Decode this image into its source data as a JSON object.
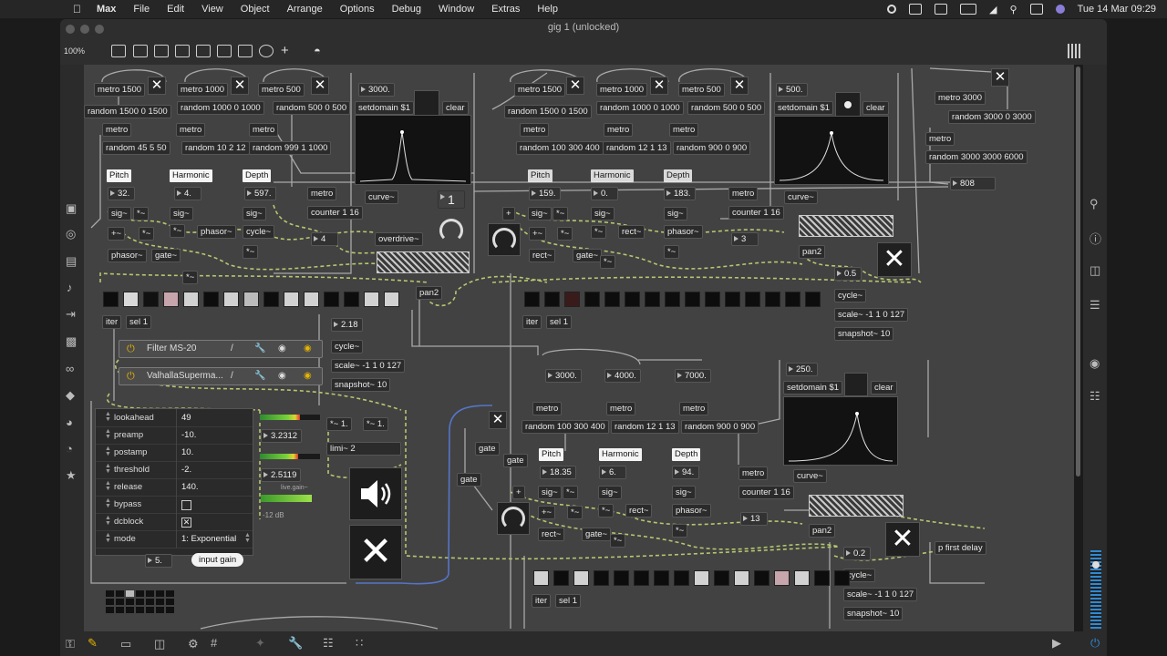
{
  "menubar": {
    "app": "Max",
    "items": [
      "File",
      "Edit",
      "View",
      "Object",
      "Arrange",
      "Options",
      "Debug",
      "Window",
      "Extras",
      "Help"
    ],
    "clock": "Tue 14 Mar  09:29"
  },
  "window": {
    "title": "gig 1 (unlocked)",
    "zoom": "100%"
  },
  "patch_a": {
    "metros": [
      "metro 1500",
      "metro 1000",
      "metro 500"
    ],
    "randoms": [
      "random 1500 0 1500",
      "random 1000 0 1000",
      "random 500 0 500"
    ],
    "metro_small": "metro",
    "rand_params": [
      "random 45 5 50",
      "random 10 2 12",
      "random 999 1 1000"
    ],
    "labels": [
      "Pitch",
      "Harmonic",
      "Depth"
    ],
    "values": [
      "32.",
      "4.",
      "597."
    ],
    "sig": "sig~",
    "star": "*~",
    "plus": "+~",
    "phasor": "phasor~",
    "cycle": "cycle~",
    "gate": "gate~",
    "tri": "*~",
    "number_top": "3000.",
    "setdomain": "setdomain $1",
    "clear": "clear",
    "counter": "counter 1 16",
    "counter_val": "4",
    "curve": "curve~",
    "one": "1",
    "overdrive": "overdrive~",
    "pan": "pan2",
    "iter": "iter",
    "sel": "sel 1",
    "cyc_val": "2.18",
    "scale": "scale~ -1 1 0 127",
    "snapshot": "snapshot~ 10"
  },
  "patch_b": {
    "metros": [
      "metro 1500",
      "metro 1000",
      "metro 500"
    ],
    "randoms": [
      "random 1500 0 1500",
      "random 1000 0 1000",
      "random 500 0 500"
    ],
    "rand_params": [
      "random 100 300 400",
      "random 12 1 13",
      "random 900 0 900"
    ],
    "labels": [
      "Pitch",
      "Harmonic",
      "Depth"
    ],
    "values": [
      "159.",
      "0.",
      "183."
    ],
    "number_top": "500.",
    "counter_val": "3",
    "rect": "rect~",
    "cyc_val": "0.5",
    "plus": "+"
  },
  "patch_c": {
    "metro": "metro 3000",
    "random1": "random 3000 0 3000",
    "metro2": "metro",
    "random2": "random 3000 3000 6000",
    "value": "808"
  },
  "patch_d": {
    "numbers": [
      "3000.",
      "4000.",
      "7000."
    ],
    "rand_params": [
      "random 100 300 400",
      "random 12 1 13",
      "random 900 0 900"
    ],
    "labels": [
      "Pitch",
      "Harmonic",
      "Depth"
    ],
    "values": [
      "18.35",
      "6.",
      "94."
    ],
    "number_top": "250.",
    "counter_val": "13",
    "cyc_val": "0.2",
    "gate": "gate",
    "first_delay": "p first delay"
  },
  "plugins": [
    {
      "name": "Filter MS-20"
    },
    {
      "name": "ValhallaSuperma..."
    }
  ],
  "limiter": {
    "rows": [
      {
        "key": "lookahead",
        "value": "49"
      },
      {
        "key": "preamp",
        "value": "-10."
      },
      {
        "key": "postamp",
        "value": "10."
      },
      {
        "key": "threshold",
        "value": "-2."
      },
      {
        "key": "release",
        "value": "140."
      },
      {
        "key": "bypass",
        "value": ""
      },
      {
        "key": "dcblock",
        "value": ""
      },
      {
        "key": "mode",
        "value": "1: Exponential"
      }
    ],
    "gain_value": "5.",
    "gain_label": "input gain",
    "meter1": "3.2312",
    "meter2": "2.5119",
    "live_gain": "live.gain~",
    "db": "-12 dB",
    "mult1": "*~ 1.",
    "mult2": "*~ 1.",
    "limi": "limi~ 2"
  },
  "colors": {
    "canvas": "#424242",
    "accent": "#e6b400",
    "signal_cable": "#b5c770",
    "blue_cable": "#5575c8"
  }
}
